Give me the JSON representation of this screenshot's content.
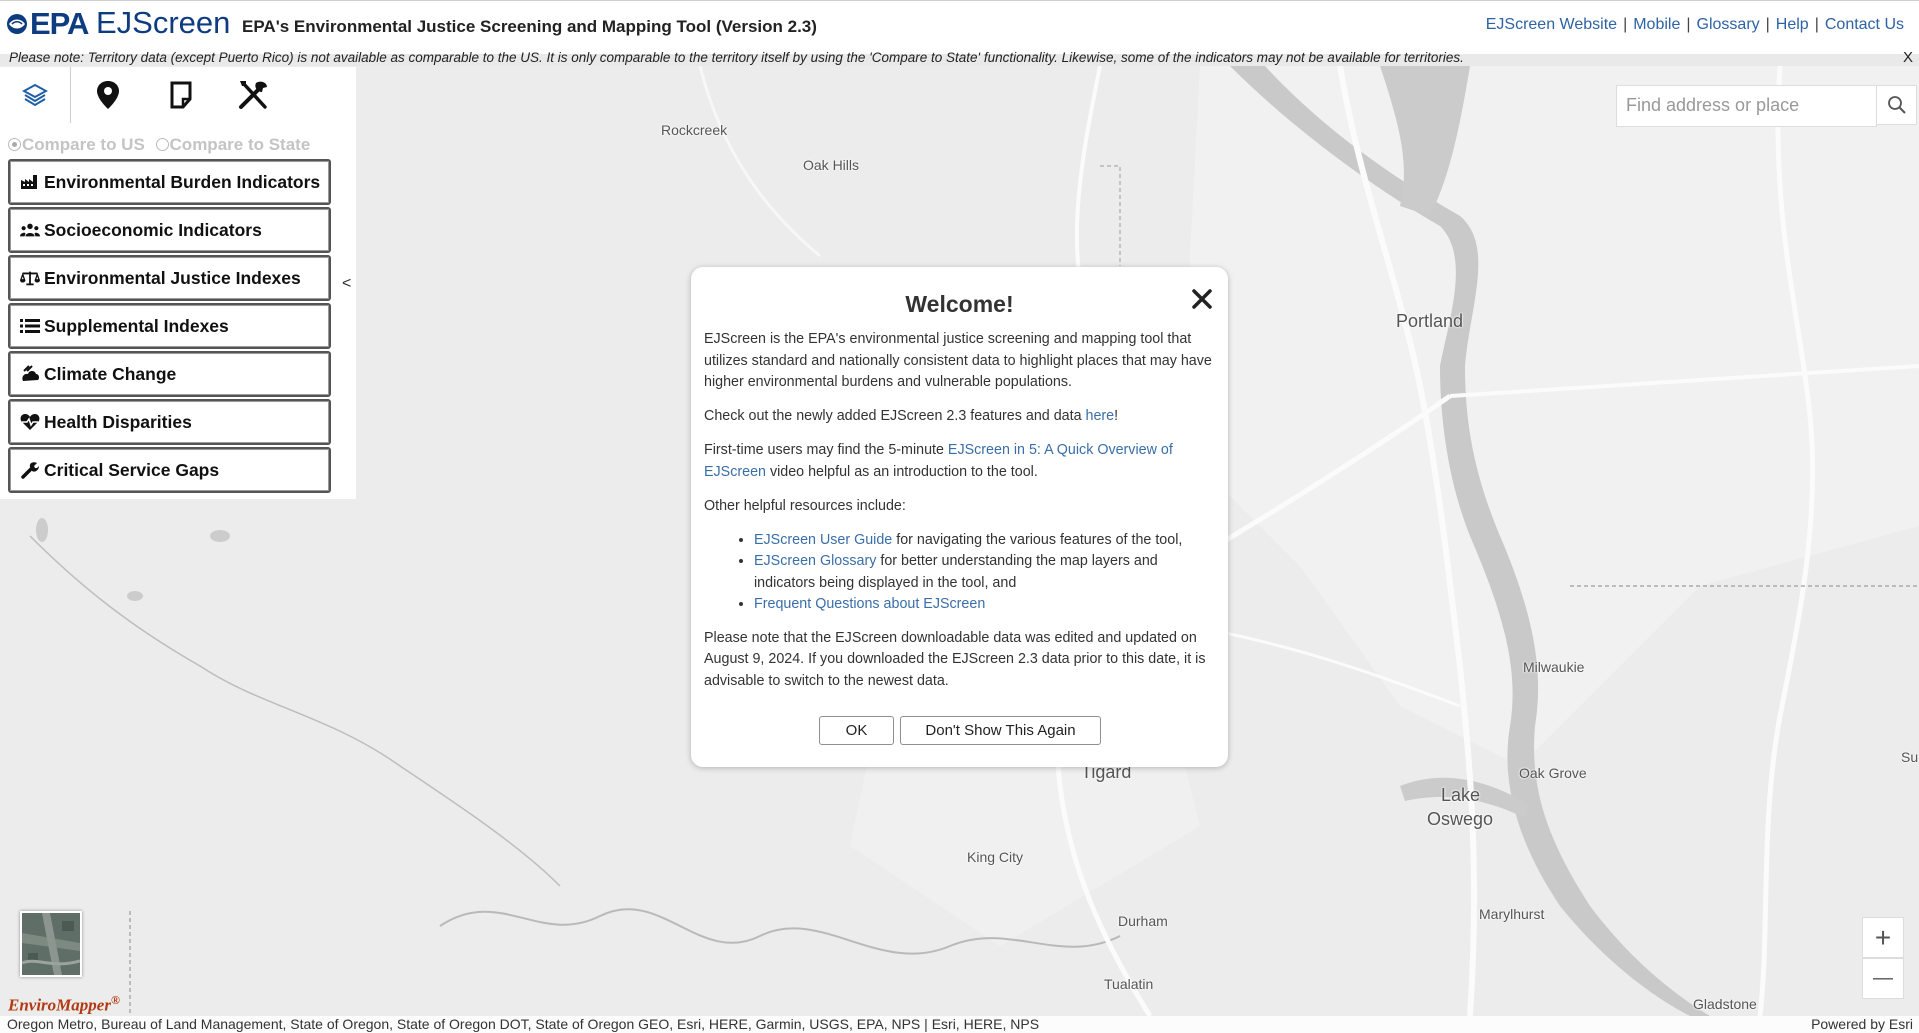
{
  "header": {
    "logo_text": "EPA",
    "app_name": "EJScreen",
    "subtitle": "EPA's Environmental Justice Screening and Mapping Tool (Version 2.3)",
    "links": [
      "EJScreen Website",
      "Mobile",
      "Glossary",
      "Help",
      "Contact Us"
    ],
    "separator": "|"
  },
  "notice": {
    "text": "Please note: Territory data (except Puerto Rico) is not available as comparable to the US. It is only comparable to the territory itself by using the 'Compare to State' functionality. Likewise, some of the indicators may not be available for territories.",
    "close_label": "X"
  },
  "panel": {
    "tabs": [
      "layers-icon",
      "map-pin-icon",
      "report-icon",
      "tools-icon"
    ],
    "compare_us": "Compare to US",
    "compare_state": "Compare to State",
    "selected_compare": "Compare to US",
    "categories": [
      {
        "label": "Environmental Burden Indicators",
        "icon": "factory-icon"
      },
      {
        "label": "Socioeconomic Indicators",
        "icon": "people-icon"
      },
      {
        "label": "Environmental Justice Indexes",
        "icon": "scale-icon"
      },
      {
        "label": "Supplemental Indexes",
        "icon": "list-icon"
      },
      {
        "label": "Climate Change",
        "icon": "climate-icon"
      },
      {
        "label": "Health Disparities",
        "icon": "heart-pulse-icon"
      },
      {
        "label": "Critical Service Gaps",
        "icon": "wrench-icon"
      }
    ],
    "collapse_label": "<"
  },
  "search": {
    "placeholder": "Find address or place"
  },
  "zoom": {
    "in_label": "+",
    "out_label": "—"
  },
  "map": {
    "places": [
      "Rockcreek",
      "Oak Hills",
      "Portland",
      "Tigard",
      "King City",
      "Durham",
      "Tualatin",
      "Lake",
      "Oswego",
      "Milwaukie",
      "Oak Grove",
      "Marylhurst",
      "Gladstone",
      "Su"
    ]
  },
  "footer": {
    "logo_text": "EnviroMapper",
    "logo_mark": "®",
    "attribution": "Oregon Metro, Bureau of Land Management, State of Oregon, State of Oregon DOT, State of Oregon GEO, Esri, HERE, Garmin, USGS, EPA, NPS | Esri, HERE, NPS",
    "powered_by": "Powered by Esri"
  },
  "modal": {
    "title": "Welcome!",
    "p1": "EJScreen is the EPA's environmental justice screening and mapping tool that utilizes standard and nationally consistent data to highlight places that may have higher environmental burdens and vulnerable populations.",
    "p2_pre": "Check out the newly added EJScreen 2.3 features and data ",
    "p2_link": "here",
    "p2_post": "!",
    "p3_pre": "First-time users may find the 5-minute ",
    "p3_link": "EJScreen in 5: A Quick Overview of EJScreen",
    "p3_post": " video helpful as an introduction to the tool.",
    "p4": "Other helpful resources include:",
    "resources": [
      {
        "link": "EJScreen User Guide",
        "text": " for navigating the various features of the tool,"
      },
      {
        "link": "EJScreen Glossary",
        "text": " for better understanding the map layers and indicators being displayed in the tool, and"
      },
      {
        "link": "Frequent Questions about EJScreen",
        "text": ""
      }
    ],
    "p5": "Please note that the EJScreen downloadable data was edited and updated on August 9, 2024. If you downloaded the EJScreen 2.3 data prior to this date, it is advisable to switch to the newest data.",
    "ok_label": "OK",
    "dont_show_label": "Don't Show This Again"
  }
}
